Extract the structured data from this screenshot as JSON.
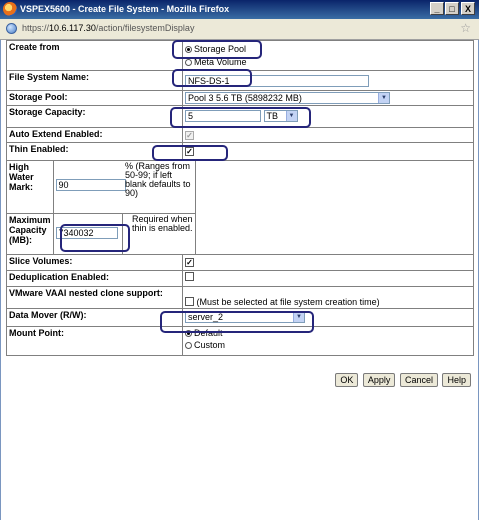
{
  "window": {
    "title": "VSPEX5600 - Create File System - Mozilla Firefox",
    "minimize": "_",
    "maximize": "□",
    "close": "X"
  },
  "address": {
    "scheme": "https://",
    "host": "10.6.117.30",
    "path": "/action/filesystemDisplay"
  },
  "form": {
    "create_from": {
      "label": "Create from",
      "options": [
        "Storage Pool",
        "Meta Volume"
      ],
      "selected": "Storage Pool"
    },
    "fs_name": {
      "label": "File System Name:",
      "value": "NFS-DS-1"
    },
    "storage_pool": {
      "label": "Storage Pool:",
      "value": "Pool 3 5.6 TB (5898232 MB)"
    },
    "storage_capacity": {
      "label": "Storage Capacity:",
      "value": "5",
      "unit": "TB"
    },
    "auto_extend": {
      "label": "Auto Extend Enabled:",
      "checked": true,
      "disabled": true
    },
    "thin_enabled": {
      "label": "Thin Enabled:",
      "checked": true
    },
    "high_water_mark": {
      "label": "High Water Mark:",
      "value": "90",
      "hint": "% (Ranges from 50-99; if left blank defaults to 90)"
    },
    "max_capacity": {
      "label": "Maximum Capacity (MB):",
      "value": "7340032",
      "hint": "Required when thin is enabled."
    },
    "slice_volumes": {
      "label": "Slice Volumes:",
      "checked": true
    },
    "dedup": {
      "label": "Deduplication Enabled:",
      "checked": false
    },
    "vaai": {
      "label": "VMware VAAI nested clone support:",
      "checked": false,
      "note": "(Must be selected at file system creation time)"
    },
    "data_mover": {
      "label": "Data Mover (R/W):",
      "value": "server_2"
    },
    "mount_point": {
      "label": "Mount Point:",
      "options": [
        "Default",
        "Custom"
      ],
      "selected": "Default"
    }
  },
  "buttons": {
    "ok": "OK",
    "apply": "Apply",
    "cancel": "Cancel",
    "help": "Help"
  },
  "icons": {
    "check": "✓",
    "dropdown": "▼",
    "star": "☆"
  }
}
